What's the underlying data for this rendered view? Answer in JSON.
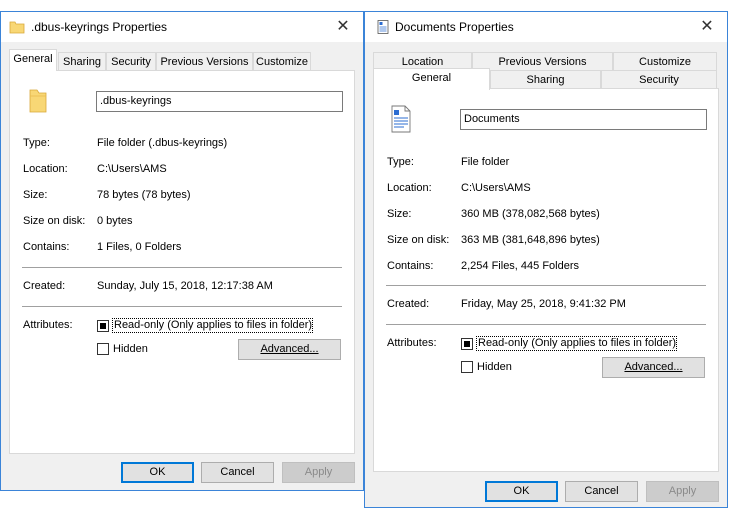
{
  "left": {
    "title": ".dbus-keyrings Properties",
    "tabs": [
      "General",
      "Sharing",
      "Security",
      "Previous Versions",
      "Customize"
    ],
    "name_value": ".dbus-keyrings",
    "rows": [
      {
        "label": "Type:",
        "value": "File folder (.dbus-keyrings)"
      },
      {
        "label": "Location:",
        "value": "C:\\Users\\AMS"
      },
      {
        "label": "Size:",
        "value": "78 bytes (78 bytes)"
      },
      {
        "label": "Size on disk:",
        "value": "0 bytes"
      },
      {
        "label": "Contains:",
        "value": "1 Files, 0 Folders"
      }
    ],
    "created_label": "Created:",
    "created_value": "Sunday, July 15, 2018, 12:17:38 AM",
    "attributes_label": "Attributes:",
    "readonly_label": "Read-only (Only applies to files in folder)",
    "hidden_label": "Hidden",
    "advanced_label": "Advanced...",
    "ok_label": "OK",
    "cancel_label": "Cancel",
    "apply_label": "Apply"
  },
  "right": {
    "title": "Documents Properties",
    "tabs_row1": [
      "Location",
      "Previous Versions",
      "Customize"
    ],
    "tabs_row2": [
      "General",
      "Sharing",
      "Security"
    ],
    "name_value": "Documents",
    "rows": [
      {
        "label": "Type:",
        "value": "File folder"
      },
      {
        "label": "Location:",
        "value": "C:\\Users\\AMS"
      },
      {
        "label": "Size:",
        "value": "360 MB (378,082,568 bytes)"
      },
      {
        "label": "Size on disk:",
        "value": "363 MB (381,648,896 bytes)"
      },
      {
        "label": "Contains:",
        "value": "2,254 Files, 445 Folders"
      }
    ],
    "created_label": "Created:",
    "created_value": "Friday, May 25, 2018, 9:41:32 PM",
    "attributes_label": "Attributes:",
    "readonly_label": "Read-only (Only applies to files in folder)",
    "hidden_label": "Hidden",
    "advanced_label": "Advanced...",
    "ok_label": "OK",
    "cancel_label": "Cancel",
    "apply_label": "Apply"
  },
  "icons": {
    "close": "close-icon",
    "folder": "folder-icon",
    "documents": "documents-icon"
  },
  "colors": {
    "window_border": "#3b84d8",
    "default_button_border": "#0078d7",
    "folder_yellow": "#f8d775"
  }
}
